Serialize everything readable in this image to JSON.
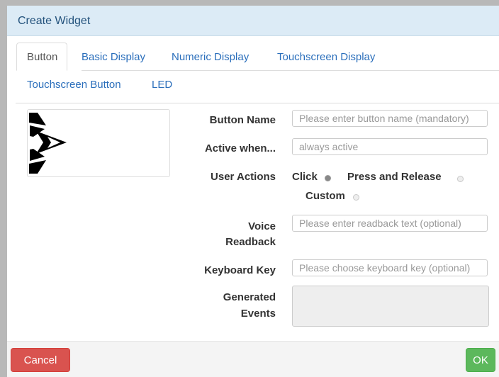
{
  "dialog": {
    "title": "Create Widget"
  },
  "tabs": [
    {
      "label": "Button",
      "active": true
    },
    {
      "label": "Basic Display"
    },
    {
      "label": "Numeric Display"
    },
    {
      "label": "Touchscreen Display"
    },
    {
      "label": "Touchscreen Button"
    },
    {
      "label": "LED"
    }
  ],
  "form": {
    "button_name": {
      "label": "Button Name",
      "placeholder": "Please enter button name (mandatory)"
    },
    "active_when": {
      "label": "Active when...",
      "placeholder": "always active"
    },
    "user_actions": {
      "label": "User Actions",
      "options": [
        {
          "label": "Click",
          "checked": true
        },
        {
          "label": "Press and Release",
          "checked": false
        },
        {
          "label": "Custom",
          "checked": false
        }
      ]
    },
    "voice_readback": {
      "label_line1": "Voice",
      "label_line2": "Readback",
      "placeholder": "Please enter readback text (optional)"
    },
    "keyboard_key": {
      "label": "Keyboard Key",
      "placeholder": "Please choose keyboard key (optional)"
    },
    "generated_events": {
      "label_line1": "Generated",
      "label_line2": "Events",
      "value": ""
    }
  },
  "footer": {
    "cancel_label": "Cancel",
    "ok_label": "OK"
  },
  "colors": {
    "cancel": "#d9534f",
    "ok": "#5cb85c",
    "title_bar": "#dcebf6",
    "link": "#2a6ebb"
  },
  "preview_icon": "play-logo-icon"
}
